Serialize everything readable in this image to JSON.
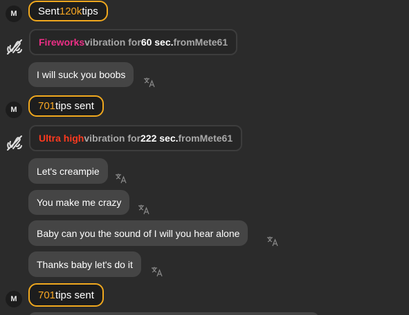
{
  "messages": {
    "tip1": {
      "avatar": "M",
      "prefix": "Sent ",
      "amount": "120k",
      "suffix": " tips"
    },
    "vib1": {
      "level": "Fireworks",
      "text1": " vibration for ",
      "duration": "60 sec.",
      "text2": " from",
      "user": "Mete61",
      "level_color": "#ec2f86"
    },
    "msg1": {
      "text": "I will suck you boobs"
    },
    "tip2": {
      "avatar": "M",
      "amount": "701",
      "suffix": " tips sent"
    },
    "vib2": {
      "level": "Ultra high",
      "text1": " vibration for ",
      "duration": "222 sec.",
      "text2": " from",
      "user": "Mete61",
      "level_color": "#ff3a1f"
    },
    "msg2": {
      "text": "Let's creampie"
    },
    "msg3": {
      "text": "You make me crazy"
    },
    "msg4": {
      "text": "Baby can you the sound of I will you hear alone"
    },
    "msg5": {
      "text": "Thanks baby let's do it"
    },
    "tip3": {
      "avatar": "M",
      "amount": "701",
      "suffix": " tips sent"
    }
  },
  "icons": {
    "vibration": "vibration-icon",
    "translate": "translate-icon"
  },
  "colors": {
    "background": "#2b2b2b",
    "tip_border": "#f0a81e",
    "tip_accent": "#f6a623",
    "bubble": "#454545"
  }
}
